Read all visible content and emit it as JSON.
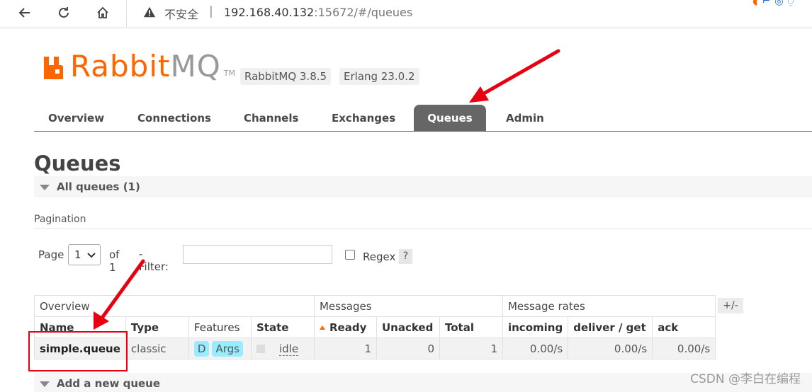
{
  "browser": {
    "insecure_label": "不安全",
    "separator": "|",
    "url_host": "192.168.40.132",
    "url_rest": ":15672/#/queues"
  },
  "header": {
    "logo_rabbit": "Rabbit",
    "logo_mq": "MQ",
    "logo_tm": "TM",
    "version_rabbitmq": "RabbitMQ 3.8.5",
    "version_erlang": "Erlang 23.0.2"
  },
  "tabs": [
    {
      "label": "Overview",
      "active": false
    },
    {
      "label": "Connections",
      "active": false
    },
    {
      "label": "Channels",
      "active": false
    },
    {
      "label": "Exchanges",
      "active": false
    },
    {
      "label": "Queues",
      "active": true
    },
    {
      "label": "Admin",
      "active": false
    }
  ],
  "main": {
    "title": "Queues",
    "all_queues_label": "All queues (1)",
    "pagination_label": "Pagination",
    "page_label": "Page",
    "page_value": "1",
    "of_label": "of 1",
    "filter_label": "- Filter:",
    "filter_value": "",
    "regex_label": "Regex",
    "help_label": "?",
    "add_queue_label": "Add a new queue"
  },
  "table": {
    "groups": [
      "Overview",
      "Messages",
      "Message rates"
    ],
    "columns": [
      "Name",
      "Type",
      "Features",
      "State",
      "Ready",
      "Unacked",
      "Total",
      "incoming",
      "deliver / get",
      "ack"
    ],
    "plus_minus": "+/-",
    "rows": [
      {
        "name": "simple.queue",
        "type": "classic",
        "features": [
          "D",
          "Args"
        ],
        "state": "idle",
        "ready": "1",
        "unacked": "0",
        "total": "1",
        "incoming": "0.00/s",
        "deliver_get": "0.00/s",
        "ack": "0.00/s"
      }
    ]
  },
  "watermark": "CSDN @李白在编程",
  "colors": {
    "brand_orange": "#ff6600",
    "tab_active": "#666666",
    "feature_badge": "#99ebff",
    "annotation_red": "#e60012"
  }
}
